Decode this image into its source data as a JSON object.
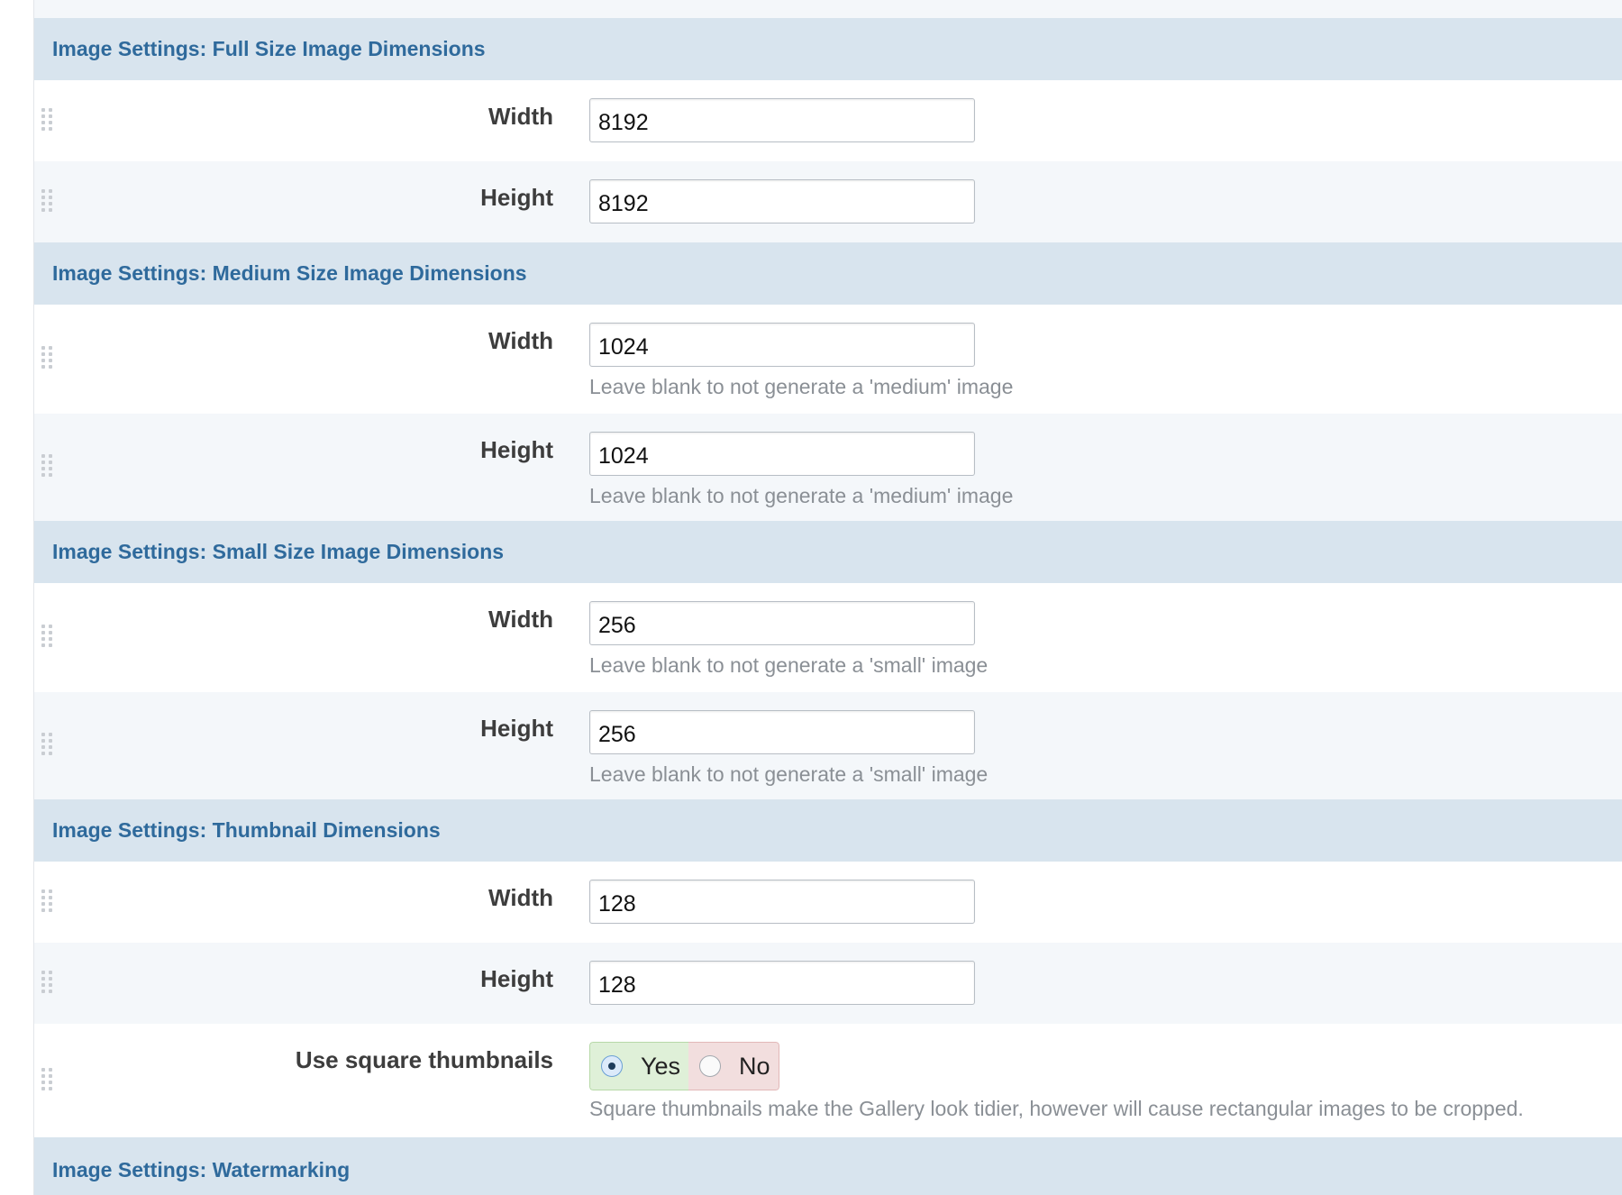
{
  "sections": [
    {
      "title": "Image Settings: Full Size Image Dimensions",
      "fields": [
        {
          "label": "Width",
          "value": "8192",
          "help": ""
        },
        {
          "label": "Height",
          "value": "8192",
          "help": ""
        }
      ]
    },
    {
      "title": "Image Settings: Medium Size Image Dimensions",
      "fields": [
        {
          "label": "Width",
          "value": "1024",
          "help": "Leave blank to not generate a 'medium' image"
        },
        {
          "label": "Height",
          "value": "1024",
          "help": "Leave blank to not generate a 'medium' image"
        }
      ]
    },
    {
      "title": "Image Settings: Small Size Image Dimensions",
      "fields": [
        {
          "label": "Width",
          "value": "256",
          "help": "Leave blank to not generate a 'small' image"
        },
        {
          "label": "Height",
          "value": "256",
          "help": "Leave blank to not generate a 'small' image"
        }
      ]
    },
    {
      "title": "Image Settings: Thumbnail Dimensions",
      "fields": [
        {
          "label": "Width",
          "value": "128",
          "help": ""
        },
        {
          "label": "Height",
          "value": "128",
          "help": ""
        }
      ],
      "toggle": {
        "label": "Use square thumbnails",
        "yes_label": "Yes",
        "no_label": "No",
        "selected": "Yes",
        "help": "Square thumbnails make the Gallery look tidier, however will cause rectangular images to be cropped."
      }
    },
    {
      "title": "Image Settings: Watermarking"
    }
  ],
  "colors": {
    "section_header_bg": "#d8e4ee",
    "section_header_text": "#2f6a9c",
    "yes_bg": "#dff0d8",
    "no_bg": "#f2dede"
  }
}
